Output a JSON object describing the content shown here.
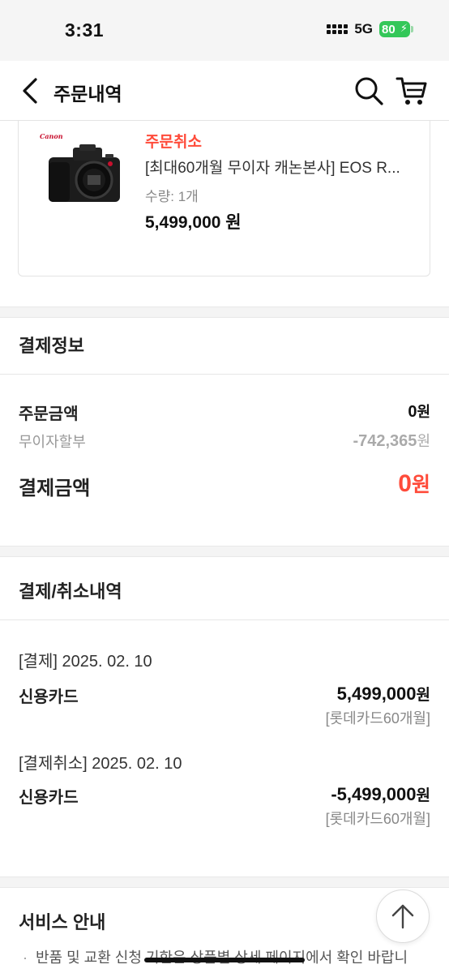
{
  "status_bar": {
    "time": "3:31",
    "network": "5G",
    "battery": "80"
  },
  "header": {
    "title": "주문내역"
  },
  "product": {
    "brand_logo": "Canon",
    "status": "주문취소",
    "name": "[최대60개월 무이자 캐논본사] EOS R...",
    "quantity": "수량: 1개",
    "price": "5,499,000 원"
  },
  "payment_info": {
    "title": "결제정보",
    "order_amount_label": "주문금액",
    "order_amount_value": "0",
    "order_amount_unit": "원",
    "installment_label": "무이자할부",
    "installment_value": "-742,365",
    "installment_unit": "원",
    "total_label": "결제금액",
    "total_value": "0",
    "total_unit": "원"
  },
  "history": {
    "title": "결제/취소내역",
    "entries": [
      {
        "header": "[결제] 2025. 02. 10",
        "method": "신용카드",
        "amount": "5,499,000",
        "unit": "원",
        "detail": "[롯데카드60개월]"
      },
      {
        "header": "[결제취소] 2025. 02. 10",
        "method": "신용카드",
        "amount": "-5,499,000",
        "unit": "원",
        "detail": "[롯데카드60개월]"
      }
    ]
  },
  "service": {
    "title": "서비스 안내",
    "note": "반품 및 교환 신청 기한은 상품별 상세 페이지에서 확인 바랍니"
  },
  "colors": {
    "accent_red": "#ff4b3a",
    "battery_green": "#34c759"
  },
  "icons": [
    "back-icon",
    "search-icon",
    "cart-icon",
    "arrow-up-icon"
  ]
}
